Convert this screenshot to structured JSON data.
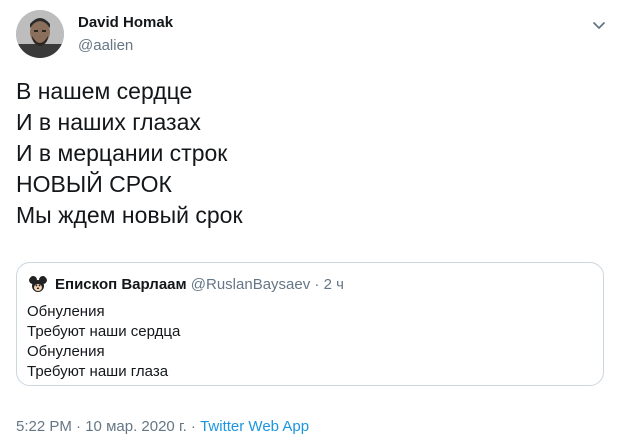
{
  "author": {
    "name": "David Homak",
    "handle": "@aalien"
  },
  "tweet_text": [
    "В нашем сердце",
    "И в наших глазах",
    "И в мерцании строк",
    "НОВЫЙ СРОК",
    "Мы ждем новый срок"
  ],
  "quoted": {
    "name": "Епископ Варлаам",
    "handle": "@RuslanBaysaev",
    "separator": " · ",
    "time": "2 ч",
    "lines": [
      "Обнуления",
      "Требуют наши сердца",
      "Обнуления",
      "Требуют наши глаза"
    ]
  },
  "footer": {
    "time": "5:22 PM",
    "separator": " · ",
    "date": "10 мар. 2020 г.",
    "app": "Twitter Web App"
  },
  "icons": {
    "menu": "chevron-down-icon",
    "avatar": "avatar",
    "quoted_avatar": "mouse-avatar"
  },
  "colors": {
    "text": "#14171a",
    "secondary": "#657786",
    "link": "#1b95e0",
    "border": "#ccd6dd"
  }
}
